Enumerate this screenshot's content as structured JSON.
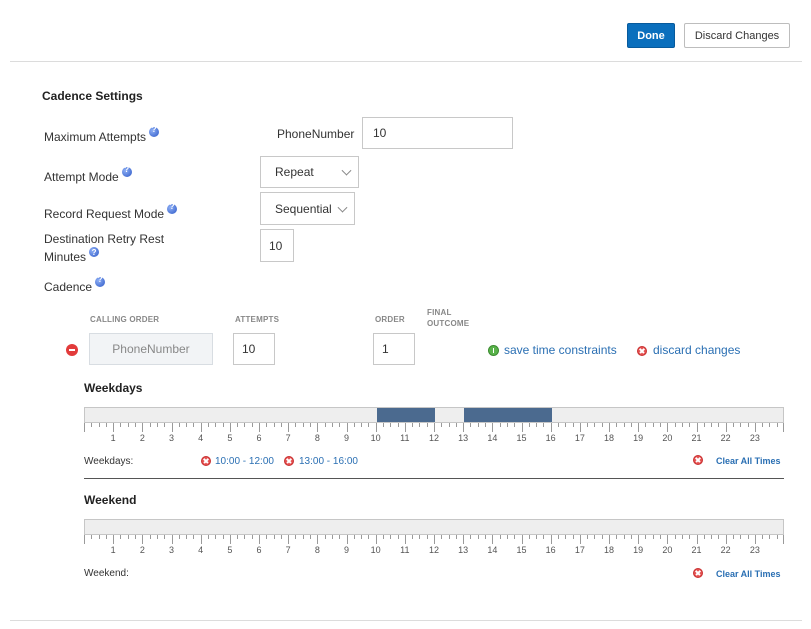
{
  "toolbar": {
    "done_label": "Done",
    "discard_label": "Discard Changes"
  },
  "cadence_settings": {
    "title": "Cadence Settings",
    "max_attempts": {
      "label": "Maximum Attempts",
      "field_label": "PhoneNumber",
      "value": "10"
    },
    "attempt_mode": {
      "label": "Attempt Mode",
      "value": "Repeat"
    },
    "record_request_mode": {
      "label": "Record Request Mode",
      "value": "Sequential"
    },
    "destination_retry": {
      "label_line1": "Destination Retry Rest",
      "label_line2": "Minutes",
      "value": "10"
    },
    "cadence_label": "Cadence"
  },
  "cadence_table": {
    "headers": {
      "calling_order": "CALLING ORDER",
      "attempts": "ATTEMPTS",
      "order": "ORDER",
      "final_outcome_1": "FINAL",
      "final_outcome_2": "OUTCOME"
    },
    "row": {
      "calling_order": "PhoneNumber",
      "attempts": "10",
      "order": "1"
    },
    "save_link": "save time constraints",
    "discard_link": "discard changes"
  },
  "weekdays": {
    "title": "Weekdays",
    "label": "Weekdays:",
    "range1": "10:00 - 12:00",
    "range2": "13:00 - 16:00",
    "segments": [
      {
        "start": 10,
        "end": 12
      },
      {
        "start": 13,
        "end": 16
      }
    ],
    "clear_label": "Clear All Times"
  },
  "weekend": {
    "title": "Weekend",
    "label": "Weekend:",
    "segments": [],
    "clear_label": "Clear All Times"
  },
  "hours": [
    "1",
    "2",
    "3",
    "4",
    "5",
    "6",
    "7",
    "8",
    "9",
    "10",
    "11",
    "12",
    "13",
    "14",
    "15",
    "16",
    "17",
    "18",
    "19",
    "20",
    "21",
    "22",
    "23"
  ],
  "colors": {
    "accent": "#0a6fbd",
    "segment": "#4b6a8f",
    "link": "#2a6fb3",
    "danger": "#e55050",
    "ok": "#59b24a"
  }
}
